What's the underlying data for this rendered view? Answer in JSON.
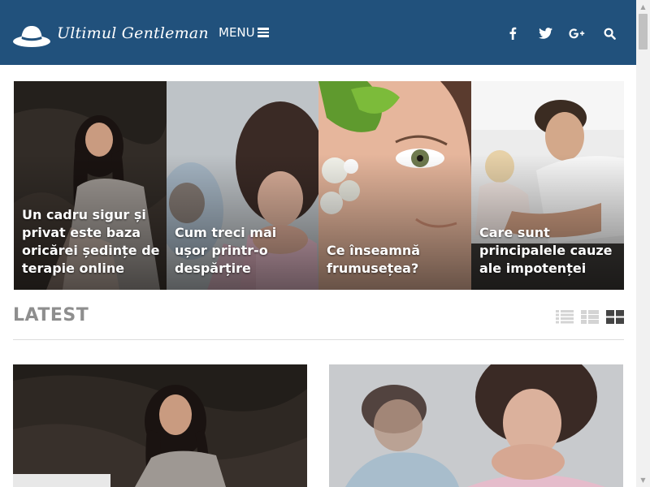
{
  "site": {
    "name": "Ultimul Gentleman",
    "menu_label": "MENU",
    "colors": {
      "header_bg": "#21517c",
      "section_title": "#8e8e8e",
      "text_light": "#ffffff"
    },
    "social_icons": [
      "facebook-icon",
      "twitter-icon",
      "google-plus-icon",
      "search-icon"
    ]
  },
  "featured": [
    {
      "title": "Un cadru sigur și privat este baza oricărei ședințe de terapie online"
    },
    {
      "title": "Cum treci mai ușor printr-o despărțire"
    },
    {
      "title": "Ce înseamnă frumusețea?"
    },
    {
      "title": "Care sunt principalele cauze ale impotenței"
    }
  ],
  "latest": {
    "heading": "LATEST",
    "view_modes": [
      "list-view-icon",
      "compact-list-view-icon",
      "grid-view-icon"
    ],
    "active_view": "grid-view-icon"
  }
}
